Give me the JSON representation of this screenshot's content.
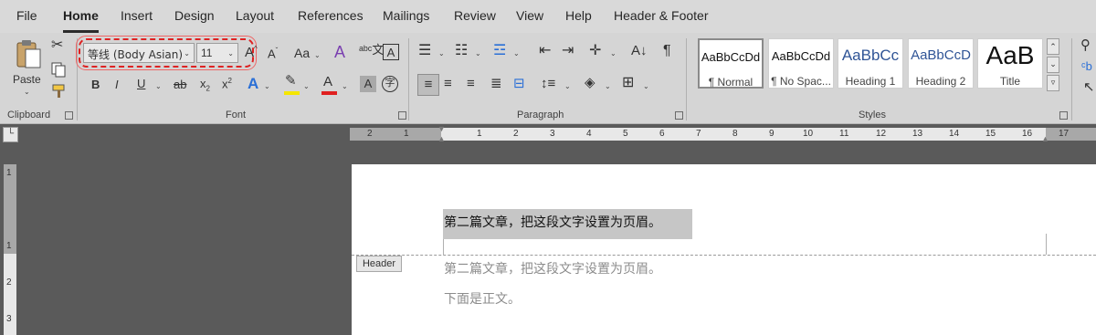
{
  "tabs": [
    "File",
    "Home",
    "Insert",
    "Design",
    "Layout",
    "References",
    "Mailings",
    "Review",
    "View",
    "Help",
    "Header & Footer"
  ],
  "active_tab": "Home",
  "clipboard": {
    "paste_label": "Paste",
    "group_label": "Clipboard"
  },
  "font": {
    "name": "等线 (Body Asian)",
    "size": "11",
    "group_label": "Font",
    "buttons": {
      "bold": "B",
      "italic": "I",
      "underline": "U",
      "strike": "ab",
      "subscript": "x",
      "superscript": "x"
    }
  },
  "paragraph": {
    "group_label": "Paragraph"
  },
  "styles": {
    "group_label": "Styles",
    "items": [
      {
        "sample": "AaBbCcDd",
        "name": "¶ Normal"
      },
      {
        "sample": "AaBbCcDd",
        "name": "¶ No Spac..."
      },
      {
        "sample": "AaBbCc",
        "name": "Heading 1"
      },
      {
        "sample": "AaBbCcD",
        "name": "Heading 2"
      },
      {
        "sample": "AaB",
        "name": "Title"
      }
    ]
  },
  "ruler": {
    "labels": [
      "2",
      "1",
      "1",
      "2",
      "3",
      "4",
      "5",
      "6",
      "7",
      "8",
      "9",
      "10",
      "11",
      "12",
      "13",
      "14",
      "15",
      "16",
      "17"
    ]
  },
  "vruler": {
    "labels": [
      "1",
      "1",
      "2",
      "3"
    ]
  },
  "document": {
    "header_label": "Header",
    "header_text": "第二篇文章，把这段文字设置为页眉。",
    "body_lines": [
      "第二篇文章，把这段文字设置为页眉。",
      "下面是正文。"
    ]
  },
  "colors": {
    "highlight_ring": "#d22222",
    "font_color_bar": "#e02020",
    "highlight_bar": "#f5e600",
    "selection": "#c6c6c6"
  }
}
